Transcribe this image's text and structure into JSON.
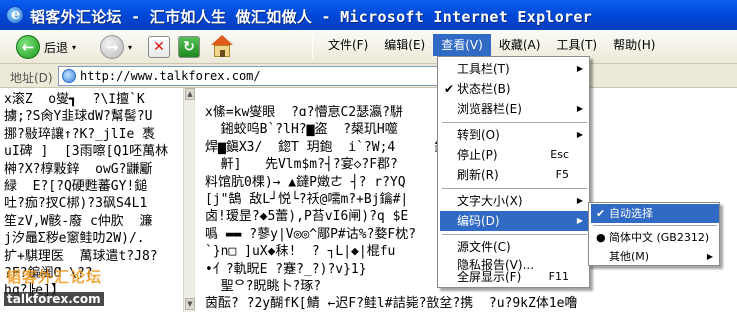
{
  "window": {
    "title": "韬客外汇论坛 - 汇市如人生 做汇如做人 - Microsoft Internet Explorer"
  },
  "toolbar": {
    "back_label": "后退",
    "back_arrow": "▾",
    "forward_arrow": "▾",
    "stop_glyph": "✕",
    "refresh_glyph": "↻"
  },
  "menubar": {
    "items": [
      "文件(F)",
      "编辑(E)",
      "查看(V)",
      "收藏(A)",
      "工具(T)",
      "帮助(H)"
    ]
  },
  "address": {
    "label": "地址(D)",
    "url": "http://www.talkforex.com/"
  },
  "view_menu": {
    "items": [
      {
        "label": "工具栏(T)",
        "submenu": true
      },
      {
        "label": "状态栏(B)",
        "checked": true
      },
      {
        "label": "浏览器栏(E)",
        "submenu": true
      },
      {
        "label": "转到(O)",
        "submenu": true
      },
      {
        "label": "停止(P)",
        "shortcut": "Esc"
      },
      {
        "label": "刷新(R)",
        "shortcut": "F5"
      },
      {
        "label": "文字大小(X)",
        "submenu": true
      },
      {
        "label": "编码(D)",
        "submenu": true,
        "highlighted": true
      },
      {
        "label": "源文件(C)"
      },
      {
        "label": "隐私报告(V)..."
      },
      {
        "label": "全屏显示(F)",
        "shortcut": "F11"
      }
    ]
  },
  "encoding_submenu": {
    "items": [
      {
        "label": "自动选择",
        "checked": true,
        "highlighted": true
      },
      {
        "label": "简体中文 (GB2312)",
        "radio": true
      },
      {
        "label": "其他(M)",
        "submenu": true
      }
    ]
  },
  "page": {
    "left_text": "x滚Z  o燮┓  ̄?\\Ι擅`K\n擄;?S肏Y韭球dW?幫髻?U\n挪?敡琗讓↑?K?_jlIe 褭\nuI碑 ]  [3雨嚓[Q1呸萬林\n榊?X?椁敤鋅  owG?鼸斸\n緑  E?[?Q硬甦蕃GY!鎚\n吐?痂?扠C梆)?3砜S4L1\n笙zV,W骸-廢 c仲肷  濂\nj汐鼂Ʃ秽e窻鲑叻2W)/.\n扩+騏理医  萬球遣t?J8?\n?F?鍽阇Ɑ \\??\nhq?╠e]】",
    "right_text": "x絛=kw燮眼  ?ɑ?懵恴C2瑟瀛?駢     ff   册睇,Q?禯P9Nr!\n  鎺蛟呜B`?lH?▆盗  ?槼玑H噬     嗣帷?搽指?鍩?  r??a銋\n焊▆鎭X3/  鍃T 玥鉋  i`?W;4     鉆     ]  ?豬嬴-%.1\n  鼾]   先Vlm$m?┤?宴◇?F郡?     ?筆搭号幇?Q?鞭+f\n料馆肮0棵)→ ▲鐽P嬍ㄜ ┤? r?YQ    o?纏4侣€By5A! €y?\n[j\"鵠 敌L┘悦└?祅@嚅m?+Bj鑰#|     \n卤!瑷昰?◆5蕾),P苔vI6闸)?q $E\n噅 ▬▬ ?蓼y|V◎◎^郮P#诂%?婺F枕?\n`}n□ ]uX◆秣!  ? ┐L|◆|棍fu\n•亻?軌眖E ?蹇?_?)?v}1}  \n  聖ᄋ?眖眺卜?琢?\n茵酝? ?2y醐fK[鯖 ←迟F?鲑l#詰毙?敨坌?携  ?u?9kZ体1e噜"
  },
  "watermark": {
    "line1": "韬客外汇论坛",
    "line2": "talkforex.com"
  }
}
